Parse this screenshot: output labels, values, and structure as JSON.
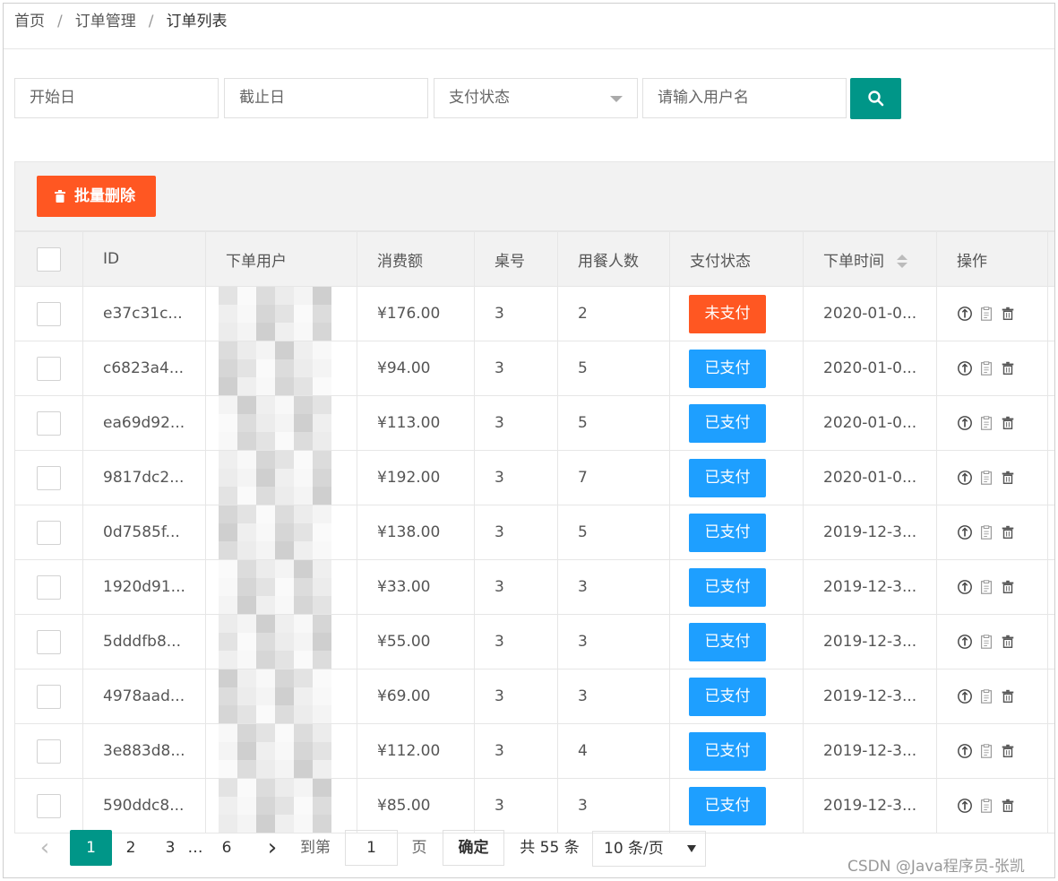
{
  "breadcrumb": [
    "首页",
    "订单管理",
    "订单列表"
  ],
  "filters": {
    "start_date_placeholder": "开始日",
    "end_date_placeholder": "截止日",
    "pay_status_placeholder": "支付状态",
    "username_placeholder": "请输入用户名"
  },
  "toolbar": {
    "batch_delete_label": "批量删除"
  },
  "table": {
    "headers": [
      "ID",
      "下单用户",
      "消费额",
      "桌号",
      "用餐人数",
      "支付状态",
      "下单时间",
      "操作"
    ],
    "rows": [
      {
        "id": "e37c31c...",
        "amount": "¥176.00",
        "table": "3",
        "people": "2",
        "status": "未支付",
        "time": "2020-01-0..."
      },
      {
        "id": "c6823a4...",
        "amount": "¥94.00",
        "table": "3",
        "people": "5",
        "status": "已支付",
        "time": "2020-01-0..."
      },
      {
        "id": "ea69d92...",
        "amount": "¥113.00",
        "table": "3",
        "people": "5",
        "status": "已支付",
        "time": "2020-01-0..."
      },
      {
        "id": "9817dc2...",
        "amount": "¥192.00",
        "table": "3",
        "people": "7",
        "status": "已支付",
        "time": "2020-01-0..."
      },
      {
        "id": "0d7585f...",
        "amount": "¥138.00",
        "table": "3",
        "people": "5",
        "status": "已支付",
        "time": "2019-12-3..."
      },
      {
        "id": "1920d91...",
        "amount": "¥33.00",
        "table": "3",
        "people": "3",
        "status": "已支付",
        "time": "2019-12-3..."
      },
      {
        "id": "5dddfb8...",
        "amount": "¥55.00",
        "table": "3",
        "people": "3",
        "status": "已支付",
        "time": "2019-12-3..."
      },
      {
        "id": "4978aad...",
        "amount": "¥69.00",
        "table": "3",
        "people": "3",
        "status": "已支付",
        "time": "2019-12-3..."
      },
      {
        "id": "3e883d8...",
        "amount": "¥112.00",
        "table": "3",
        "people": "4",
        "status": "已支付",
        "time": "2019-12-3..."
      },
      {
        "id": "590ddc8...",
        "amount": "¥85.00",
        "table": "3",
        "people": "3",
        "status": "已支付",
        "time": "2019-12-3..."
      }
    ],
    "row_icons": [
      "upload-icon",
      "document-icon",
      "trash-icon"
    ]
  },
  "pagination": {
    "prev": "‹",
    "pages": [
      "1",
      "2",
      "3",
      "…",
      "6"
    ],
    "next": "›",
    "goto_label": "到第",
    "goto_value": "1",
    "page_unit": "页",
    "confirm_label": "确定",
    "total_label": "共 55 条",
    "page_size": "10 条/页"
  },
  "watermark": "CSDN @Java程序员-张凯",
  "colors": {
    "primary": "#009688",
    "danger": "#ff5722",
    "paid": "#1e9fff",
    "unpaid": "#ff5722"
  }
}
